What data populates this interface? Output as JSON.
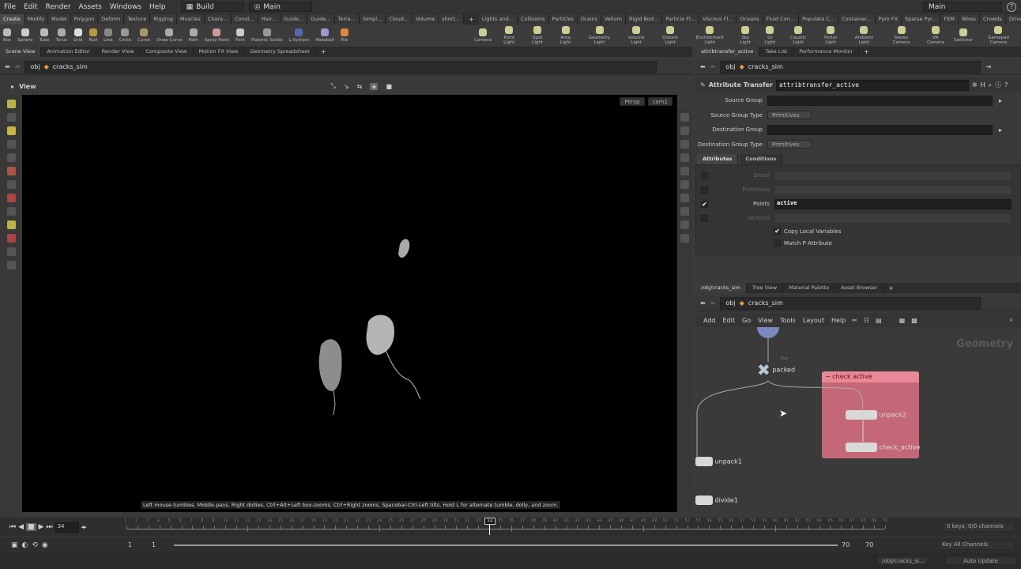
{
  "menubar": {
    "items": [
      "File",
      "Edit",
      "Render",
      "Assets",
      "Windows",
      "Help"
    ],
    "desktop": "Build",
    "desktop_right": "Main",
    "help_icon": "?"
  },
  "shelf_tabs_left": [
    "Create",
    "Modify",
    "Model",
    "Polygon",
    "Deform",
    "Texture",
    "Rigging",
    "Muscles",
    "Chara...",
    "Const...",
    "Hair...",
    "Guide...",
    "Guide...",
    "Terra...",
    "Simpl...",
    "Cloud...",
    "Volume",
    "short..."
  ],
  "shelf_tabs_right": [
    "Lights and...",
    "Collisions",
    "Particles",
    "Grains",
    "Vellum",
    "Rigid Bod...",
    "Particle Fl...",
    "Viscous Fl...",
    "Oceans",
    "Fluid Con...",
    "Populate C...",
    "Container...",
    "Pyro FX",
    "Sparse Pyr...",
    "FEM",
    "Wires",
    "Crowds",
    "Drive Sim..."
  ],
  "shelf_tools_left": [
    "Box",
    "Sphere",
    "Tube",
    "Torus",
    "Grid",
    "Null",
    "Line",
    "Circle",
    "Curve",
    "Draw Curve",
    "Path",
    "Spray Paint",
    "Font",
    "Platonic Solids",
    "L-System",
    "Metaball",
    "File"
  ],
  "shelf_tools_right": [
    "Camera",
    "Point Light",
    "Spot Light",
    "Area Light",
    "Geometry Light",
    "Volume Light",
    "Distant Light",
    "Environment Light",
    "Sky Light",
    "GI Light",
    "Caustic Light",
    "Portal Light",
    "Ambient Light",
    "Stereo Camera",
    "VR Camera",
    "Switcher",
    "Gamepad Camera"
  ],
  "left_pane": {
    "tabs": [
      "Scene View",
      "Animation Editor",
      "Render View",
      "Composite View",
      "Motion FX View",
      "Geometry Spreadsheet"
    ],
    "path": [
      "obj",
      "cracks_sim"
    ],
    "view_label": "View",
    "persp": "Persp",
    "cam": "cam1",
    "hint": "Left mouse tumbles. Middle pans. Right dollies. Ctrl+Alt+Left box-zooms. Ctrl+Right zooms. Spacebar-Ctrl-Left tilts. Hold L for alternate tumble, dolly, and zoom."
  },
  "param_pane": {
    "tabs": [
      "attribtransfer_active",
      "Take List",
      "Performance Monitor"
    ],
    "path": [
      "obj",
      "cracks_sim"
    ],
    "node_type": "Attribute Transfer",
    "node_name": "attribtransfer_active",
    "params": [
      {
        "label": "Source Group",
        "value": ""
      },
      {
        "label": "Source Group Type",
        "value": "Primitives"
      },
      {
        "label": "Destination Group",
        "value": ""
      },
      {
        "label": "Destination Group Type",
        "value": "Primitives"
      }
    ],
    "subtabs": [
      "Attributes",
      "Conditions"
    ],
    "attribs": [
      {
        "label": "Detail",
        "value": "",
        "checked": false
      },
      {
        "label": "Primitives",
        "value": "",
        "checked": false
      },
      {
        "label": "Points",
        "value": "active",
        "checked": true
      },
      {
        "label": "Vertices",
        "value": "",
        "checked": false
      }
    ],
    "toggles": [
      {
        "label": "Copy Local Variables",
        "checked": true
      },
      {
        "label": "Match P Attribute",
        "checked": false
      }
    ]
  },
  "network": {
    "tabs": [
      "/obj/cracks_sim",
      "Tree View",
      "Material Palette",
      "Asset Browser"
    ],
    "path": [
      "obj",
      "cracks_sim"
    ],
    "menu": [
      "Add",
      "Edit",
      "Go",
      "View",
      "Tools",
      "Layout",
      "Help"
    ],
    "context_label": "Geometry",
    "nodes": {
      "packed": "packed",
      "packed_flag": "Null",
      "unpack1": "unpack1",
      "divide1": "divide1",
      "unpack2": "unpack2",
      "check_active": "check_active"
    },
    "netbox": "check active",
    "netbox_color": "#e06d80"
  },
  "timeline": {
    "current_frame": "34",
    "frame_marker": "34",
    "start": "1",
    "start2": "1",
    "end": "70",
    "end2": "70",
    "frames_max": 70,
    "keys": "0 keys, 0/0 channels",
    "key_mode": "Key All Channels"
  },
  "status": {
    "path": "/obj/cracks_si...",
    "update": "Auto Update"
  }
}
